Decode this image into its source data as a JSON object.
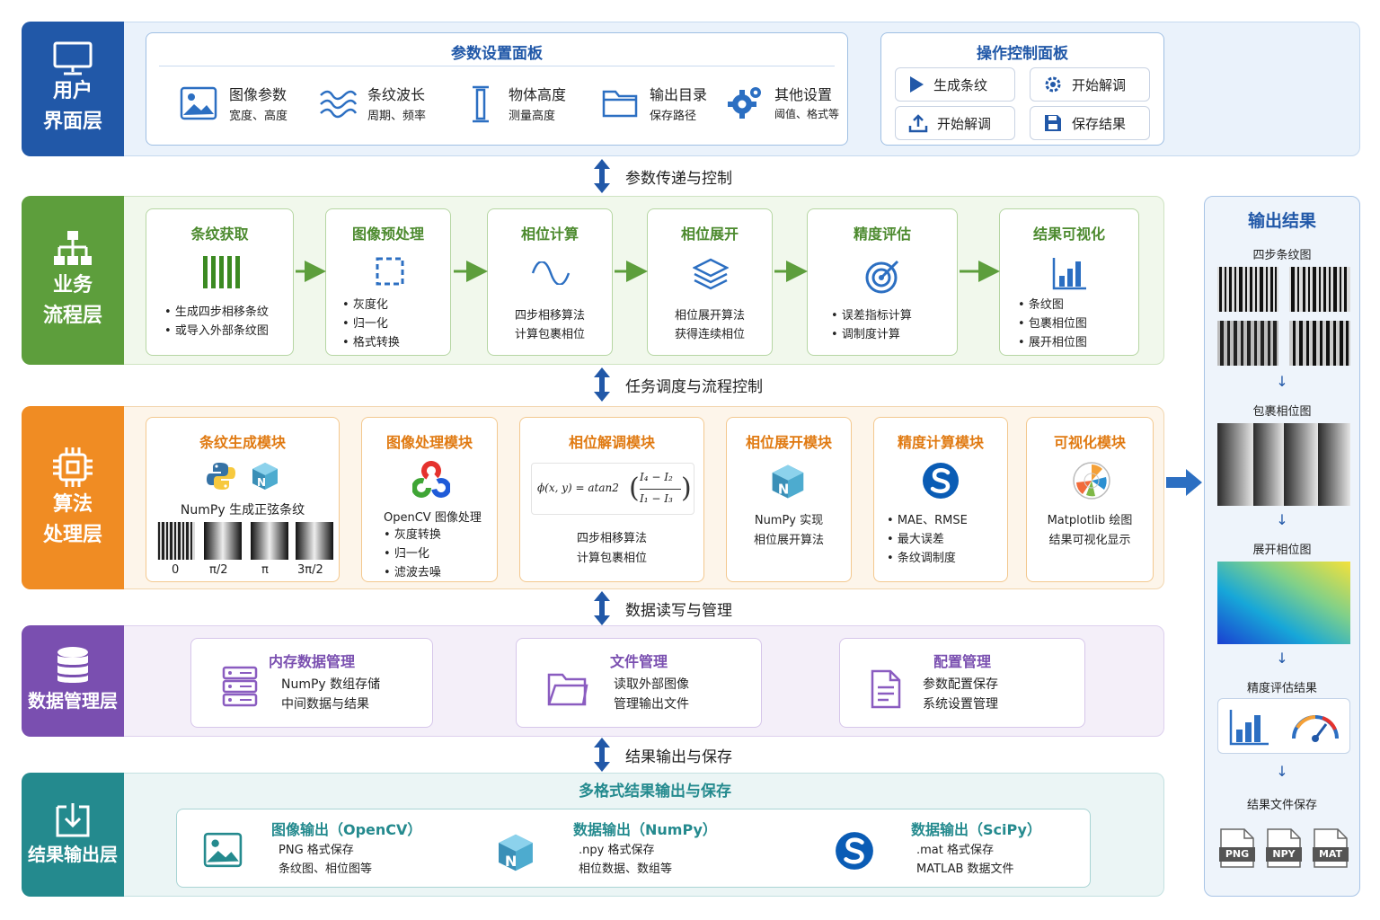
{
  "layers": {
    "ui": {
      "label": "用户\n界面层",
      "color": "#2158a8",
      "band": "#eaf2fb"
    },
    "biz": {
      "label": "业务\n流程层",
      "color": "#5d9e3c",
      "band": "#eef7e8"
    },
    "algo": {
      "label": "算法\n处理层",
      "color": "#f08c23",
      "band": "#fdf3e6"
    },
    "data": {
      "label": "数据管理层",
      "color": "#7a4fb0",
      "band": "#f2ecf9"
    },
    "out": {
      "label": "结果输出层",
      "color": "#248a8e",
      "band": "#e8f4f4"
    }
  },
  "param_panel": {
    "title": "参数设置面板",
    "items": [
      {
        "name": "图像参数",
        "sub": "宽度、高度",
        "icon": "image-icon"
      },
      {
        "name": "条纹波长",
        "sub": "周期、频率",
        "icon": "wave-icon"
      },
      {
        "name": "物体高度",
        "sub": "测量高度",
        "icon": "height-icon"
      },
      {
        "name": "输出目录",
        "sub": "保存路径",
        "icon": "folder-icon"
      },
      {
        "name": "其他设置",
        "sub": "阈值、格式等",
        "icon": "gear-icon"
      }
    ]
  },
  "control_panel": {
    "title": "操作控制面板",
    "buttons": [
      {
        "label": "生成条纹",
        "icon": "play-icon"
      },
      {
        "label": "开始解调",
        "icon": "settings-icon"
      },
      {
        "label": "开始解调",
        "icon": "upload-icon"
      },
      {
        "label": "保存结果",
        "icon": "save-icon"
      }
    ]
  },
  "connectors": [
    "参数传递与控制",
    "任务调度与流程控制",
    "数据读写与管理",
    "结果输出与保存"
  ],
  "flow_steps": [
    {
      "title": "条纹获取",
      "bullets": [
        "生成四步相移条纹",
        "或导入外部条纹图"
      ],
      "icon": "stripes-icon"
    },
    {
      "title": "图像预处理",
      "bullets": [
        "灰度化",
        "归一化",
        "格式转换"
      ],
      "icon": "crop-icon"
    },
    {
      "title": "相位计算",
      "lines": [
        "四步相移算法",
        "计算包裹相位"
      ],
      "icon": "sine-icon"
    },
    {
      "title": "相位展开",
      "lines": [
        "相位展开算法",
        "获得连续相位"
      ],
      "icon": "layers-icon"
    },
    {
      "title": "精度评估",
      "bullets": [
        "误差指标计算",
        "调制度计算"
      ],
      "icon": "target-icon"
    },
    {
      "title": "结果可视化",
      "bullets": [
        "条纹图",
        "包裹相位图",
        "展开相位图"
      ],
      "icon": "bar-chart-icon"
    }
  ],
  "modules": {
    "fringe": {
      "title": "条纹生成模块",
      "text": "NumPy 生成正弦条纹",
      "phases": [
        "0",
        "π/2",
        "π",
        "3π/2"
      ]
    },
    "image": {
      "title": "图像处理模块",
      "text": "OpenCV 图像处理",
      "bullets": [
        "灰度转换",
        "归一化",
        "滤波去噪"
      ]
    },
    "phase": {
      "title": "相位解调模块",
      "formula_lhs": "ϕ(x, y) = atan2",
      "num": "I₄ − I₂",
      "den": "I₁ − I₃",
      "lines": [
        "四步相移算法",
        "计算包裹相位"
      ]
    },
    "unwrap": {
      "title": "相位展开模块",
      "lines": [
        "NumPy 实现",
        "相位展开算法"
      ]
    },
    "precision": {
      "title": "精度计算模块",
      "bullets": [
        "MAE、RMSE",
        "最大误差",
        "条纹调制度"
      ]
    },
    "viz": {
      "title": "可视化模块",
      "lines": [
        "Matplotlib 绘图",
        "结果可视化显示"
      ]
    }
  },
  "data_mgmt": [
    {
      "title": "内存数据管理",
      "lines": [
        "NumPy 数组存储",
        "中间数据与结果"
      ],
      "icon": "server-icon"
    },
    {
      "title": "文件管理",
      "lines": [
        "读取外部图像",
        "管理输出文件"
      ],
      "icon": "folder-icon"
    },
    {
      "title": "配置管理",
      "lines": [
        "参数配置保存",
        "系统设置管理"
      ],
      "icon": "document-icon"
    }
  ],
  "output_layer": {
    "title": "多格式结果输出与保存",
    "items": [
      {
        "title": "图像输出（OpenCV）",
        "lines": [
          "PNG 格式保存",
          "条纹图、相位图等"
        ],
        "icon": "image-icon"
      },
      {
        "title": "数据输出（NumPy）",
        "lines": [
          ".npy 格式保存",
          "相位数据、数组等"
        ],
        "icon": "numpy-icon"
      },
      {
        "title": "数据输出（SciPy）",
        "lines": [
          ".mat 格式保存",
          "MATLAB 数据文件"
        ],
        "icon": "scipy-icon"
      }
    ]
  },
  "results_panel": {
    "title": "输出结果",
    "fringe_label": "四步条纹图",
    "wrapped_label": "包裹相位图",
    "unwrapped_label": "展开相位图",
    "precision_label": "精度评估结果",
    "files_label": "结果文件保存",
    "files": [
      "PNG",
      "NPY",
      "MAT"
    ]
  }
}
